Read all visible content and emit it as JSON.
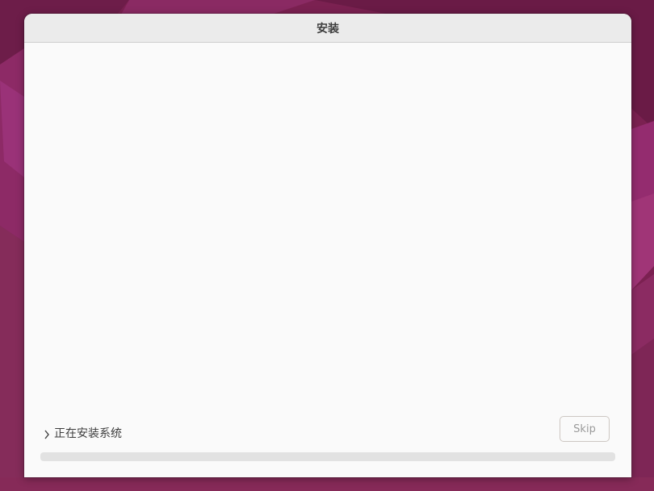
{
  "window": {
    "title": "安装"
  },
  "installer": {
    "status_text": "正在安装系统",
    "skip_label": "Skip",
    "progress": 0
  },
  "icons": {
    "status_toggle": "chevron-right-icon"
  },
  "colors": {
    "wallpaper": "#7a2150",
    "window_bg": "#fafafa",
    "titlebar_bg": "#ebebeb",
    "progress_track": "#e2e2e2"
  }
}
